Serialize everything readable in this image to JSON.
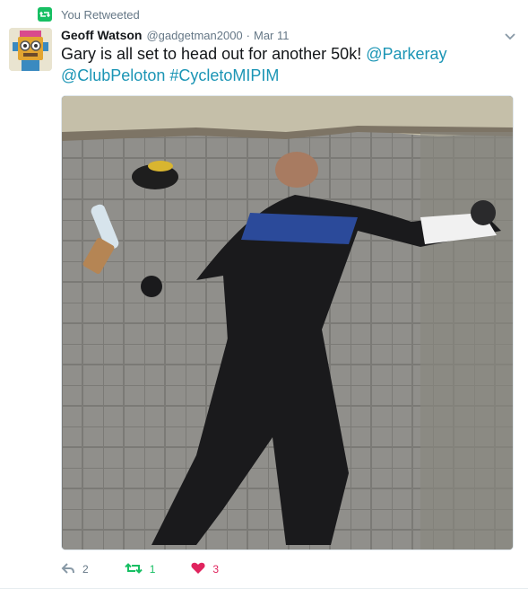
{
  "retweet_banner": {
    "label": "You Retweeted",
    "icon": "retweet-icon",
    "color": "#17bf63"
  },
  "author": {
    "name": "Geoff Watson",
    "handle": "@gadgetman2000",
    "separator": "·",
    "timestamp": "Mar 11"
  },
  "tweet": {
    "text_lead": "Gary is all set to head out for another 50k!",
    "mention_1": "@Parkeray",
    "mention_2": "@ClubPeloton",
    "hashtag": "#CycletoMIPIM"
  },
  "actions": {
    "reply_count": "2",
    "retweet_count": "1",
    "like_count": "3"
  },
  "colors": {
    "link": "#1b95b5",
    "retweet": "#17bf63",
    "like": "#e0245e",
    "muted": "#657786"
  }
}
